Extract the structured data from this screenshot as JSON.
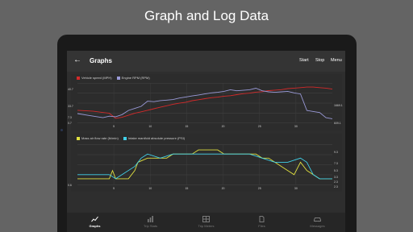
{
  "headline": "Graph and Log Data",
  "appbar": {
    "title": "Graphs",
    "actions": [
      "Start",
      "Stop",
      "Menu"
    ]
  },
  "chart_data": [
    {
      "type": "line",
      "series": [
        {
          "name": "Vehicle speed (MPH)",
          "color": "#d42a2a",
          "values": [
            [
              0,
              21
            ],
            [
              5,
              19
            ],
            [
              10,
              15
            ],
            [
              12,
              5
            ],
            [
              14,
              7
            ],
            [
              16,
              11
            ],
            [
              18,
              15
            ],
            [
              20,
              18
            ],
            [
              22,
              21
            ],
            [
              24,
              24
            ],
            [
              26,
              27
            ],
            [
              28,
              30
            ],
            [
              30,
              33
            ],
            [
              32,
              35
            ],
            [
              34,
              37
            ],
            [
              36,
              40
            ],
            [
              38,
              42
            ],
            [
              40,
              44
            ],
            [
              42,
              46
            ],
            [
              44,
              47
            ],
            [
              46,
              49
            ],
            [
              48,
              50
            ],
            [
              50,
              52
            ],
            [
              52,
              54
            ],
            [
              54,
              55
            ],
            [
              56,
              57
            ],
            [
              58,
              58
            ],
            [
              60,
              60
            ],
            [
              62,
              61
            ],
            [
              64,
              62
            ],
            [
              66,
              64
            ],
            [
              68,
              65
            ],
            [
              70,
              66
            ],
            [
              72,
              67
            ],
            [
              74,
              67
            ],
            [
              76,
              66
            ],
            [
              78,
              65
            ],
            [
              80,
              63
            ]
          ]
        },
        {
          "name": "Engine RPM (RPM)",
          "color": "#9a9ad8",
          "values": [
            [
              0,
              1200
            ],
            [
              4,
              1000
            ],
            [
              8,
              800
            ],
            [
              10,
              950
            ],
            [
              12,
              900
            ],
            [
              14,
              1100
            ],
            [
              16,
              1500
            ],
            [
              18,
              1700
            ],
            [
              20,
              1900
            ],
            [
              22,
              2400
            ],
            [
              24,
              2350
            ],
            [
              26,
              2450
            ],
            [
              28,
              2500
            ],
            [
              30,
              2550
            ],
            [
              32,
              2700
            ],
            [
              34,
              2800
            ],
            [
              36,
              2900
            ],
            [
              38,
              3000
            ],
            [
              40,
              3100
            ],
            [
              42,
              3200
            ],
            [
              44,
              3250
            ],
            [
              46,
              3350
            ],
            [
              48,
              3500
            ],
            [
              50,
              3400
            ],
            [
              52,
              3450
            ],
            [
              54,
              3500
            ],
            [
              56,
              3650
            ],
            [
              58,
              3400
            ],
            [
              60,
              3300
            ],
            [
              62,
              3250
            ],
            [
              64,
              3300
            ],
            [
              66,
              3350
            ],
            [
              68,
              3200
            ],
            [
              70,
              3100
            ],
            [
              72,
              1500
            ],
            [
              74,
              1400
            ],
            [
              76,
              1300
            ],
            [
              78,
              800
            ],
            [
              80,
              700
            ]
          ]
        }
      ],
      "y_left_ticks": [
        "40.7",
        "33.7",
        "7.3",
        "0.7"
      ],
      "y_right_ticks": [
        "1669.1",
        "609.1"
      ],
      "x_ticks": [
        "5",
        "10",
        "15",
        "20",
        "25",
        "30"
      ]
    },
    {
      "type": "line",
      "series": [
        {
          "name": "Mass air flow rate (lb/min)",
          "color": "#e0e040",
          "values": [
            [
              0,
              1
            ],
            [
              10,
              1
            ],
            [
              11,
              3
            ],
            [
              12,
              1
            ],
            [
              14,
              1
            ],
            [
              16,
              1
            ],
            [
              18,
              3
            ],
            [
              19,
              5
            ],
            [
              22,
              6
            ],
            [
              26,
              6
            ],
            [
              28,
              6
            ],
            [
              30,
              7
            ],
            [
              32,
              7
            ],
            [
              36,
              7
            ],
            [
              38,
              8
            ],
            [
              40,
              8
            ],
            [
              44,
              8
            ],
            [
              46,
              7
            ],
            [
              50,
              7
            ],
            [
              56,
              7
            ],
            [
              58,
              6
            ],
            [
              60,
              6
            ],
            [
              64,
              4
            ],
            [
              66,
              3
            ],
            [
              68,
              2
            ],
            [
              70,
              5
            ],
            [
              72,
              3
            ],
            [
              74,
              2
            ],
            [
              76,
              1
            ],
            [
              80,
              1
            ]
          ]
        },
        {
          "name": "Intake manifold absolute pressure (PSI)",
          "color": "#40d0e8",
          "values": [
            [
              0,
              2
            ],
            [
              10,
              2
            ],
            [
              12,
              1
            ],
            [
              14,
              2
            ],
            [
              18,
              4
            ],
            [
              20,
              6
            ],
            [
              22,
              7
            ],
            [
              26,
              6
            ],
            [
              30,
              7
            ],
            [
              34,
              7
            ],
            [
              38,
              7
            ],
            [
              42,
              7
            ],
            [
              46,
              7
            ],
            [
              50,
              7
            ],
            [
              54,
              7
            ],
            [
              58,
              6
            ],
            [
              62,
              5
            ],
            [
              66,
              5
            ],
            [
              70,
              6
            ],
            [
              72,
              5
            ],
            [
              74,
              2
            ],
            [
              76,
              1
            ],
            [
              80,
              1
            ]
          ]
        }
      ],
      "y_left_ticks": [
        "0.6"
      ],
      "y_right_ticks": [
        "9.3",
        "7.3",
        "5.3",
        "3.3",
        "2.3",
        "2.3"
      ],
      "x_ticks": [
        "5",
        "10",
        "15",
        "20",
        "25",
        "30"
      ]
    }
  ],
  "legend1": [
    "Vehicle speed (MPH)",
    "Engine RPM (RPM)"
  ],
  "legend2": [
    "Mass air flow rate (lb/min)",
    "Intake manifold absolute pressure (PSI)"
  ],
  "nav": [
    {
      "label": "Graphs",
      "icon": "line-chart-icon",
      "active": true
    },
    {
      "label": "Trip Stats",
      "icon": "bar-chart-icon",
      "active": false
    },
    {
      "label": "Trip Meters",
      "icon": "meters-icon",
      "active": false
    },
    {
      "label": "Files",
      "icon": "file-icon",
      "active": false
    },
    {
      "label": "Messages",
      "icon": "car-icon",
      "active": false
    }
  ]
}
